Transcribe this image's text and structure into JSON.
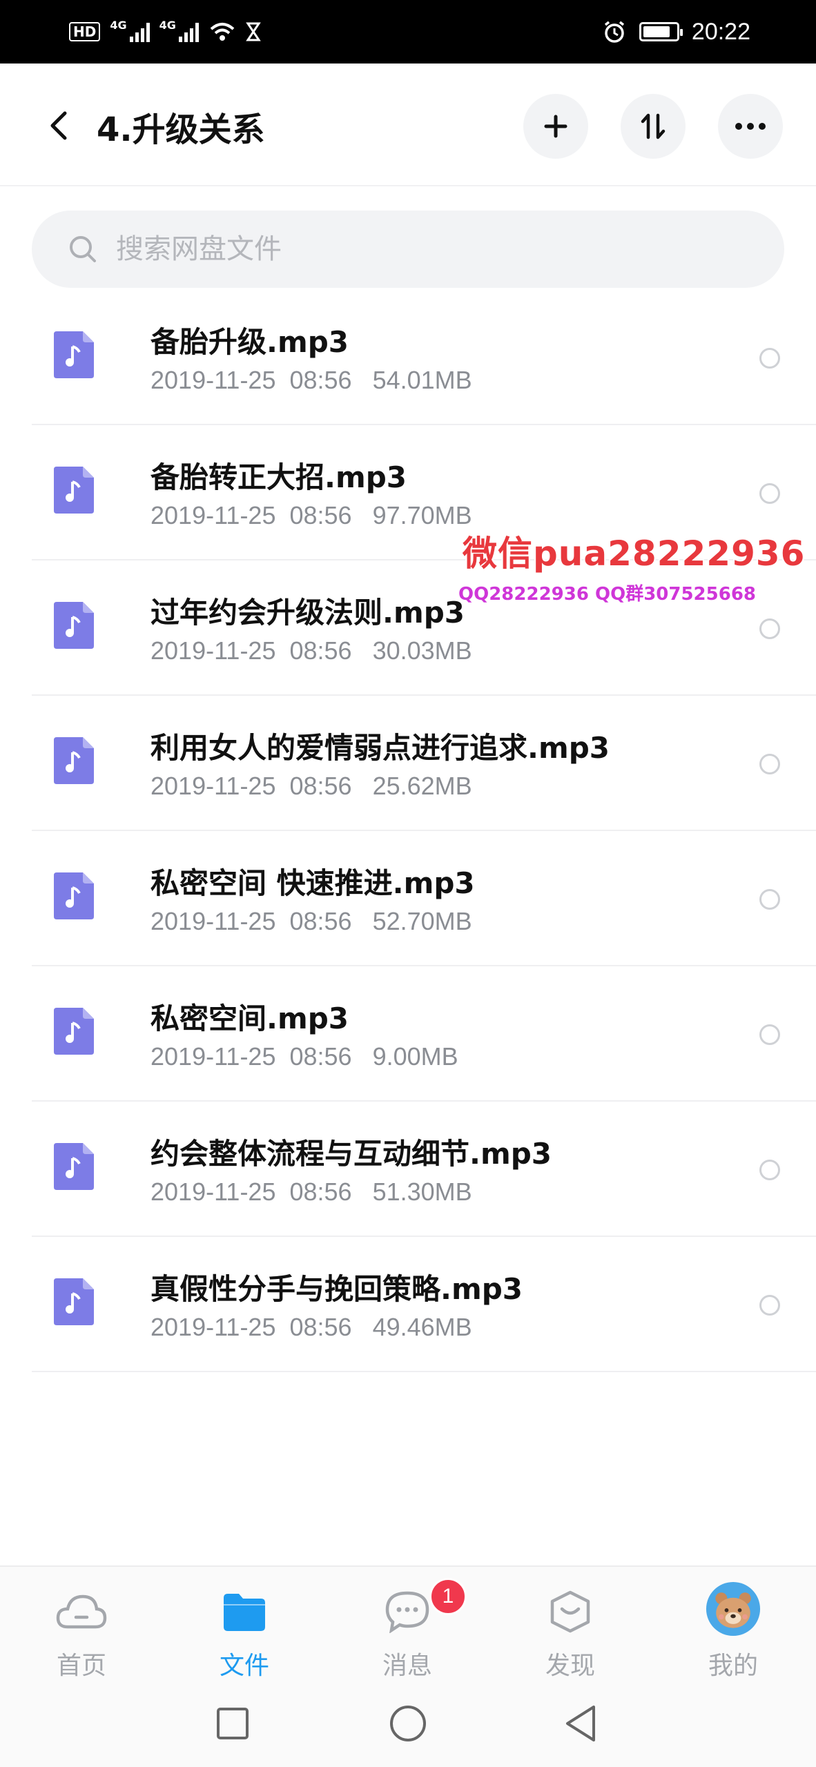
{
  "status_bar": {
    "hd_label": "HD",
    "net1": "4G",
    "net2": "4G",
    "time": "20:22"
  },
  "header": {
    "title": "4.升级关系"
  },
  "search": {
    "placeholder": "搜索网盘文件"
  },
  "files": [
    {
      "name": "备胎升级.mp3",
      "meta": "2019-11-25  08:56   54.01MB"
    },
    {
      "name": "备胎转正大招.mp3",
      "meta": "2019-11-25  08:56   97.70MB"
    },
    {
      "name": "过年约会升级法则.mp3",
      "meta": "2019-11-25  08:56   30.03MB"
    },
    {
      "name": "利用女人的爱情弱点进行追求.mp3",
      "meta": "2019-11-25  08:56   25.62MB"
    },
    {
      "name": "私密空间 快速推进.mp3",
      "meta": "2019-11-25  08:56   52.70MB"
    },
    {
      "name": "私密空间.mp3",
      "meta": "2019-11-25  08:56   9.00MB"
    },
    {
      "name": "约会整体流程与互动细节.mp3",
      "meta": "2019-11-25  08:56   51.30MB"
    },
    {
      "name": "真假性分手与挽回策略.mp3",
      "meta": "2019-11-25  08:56   49.46MB"
    }
  ],
  "watermark": {
    "line1": "微信pua28222936",
    "line2": "QQ28222936 QQ群307525668"
  },
  "tabs": {
    "home": "首页",
    "files": "文件",
    "messages": "消息",
    "messages_badge": "1",
    "discover": "发现",
    "me": "我的"
  },
  "colors": {
    "accent": "#1e9bf0",
    "file_icon": "#7d7ce6",
    "badge": "#f0384d"
  }
}
